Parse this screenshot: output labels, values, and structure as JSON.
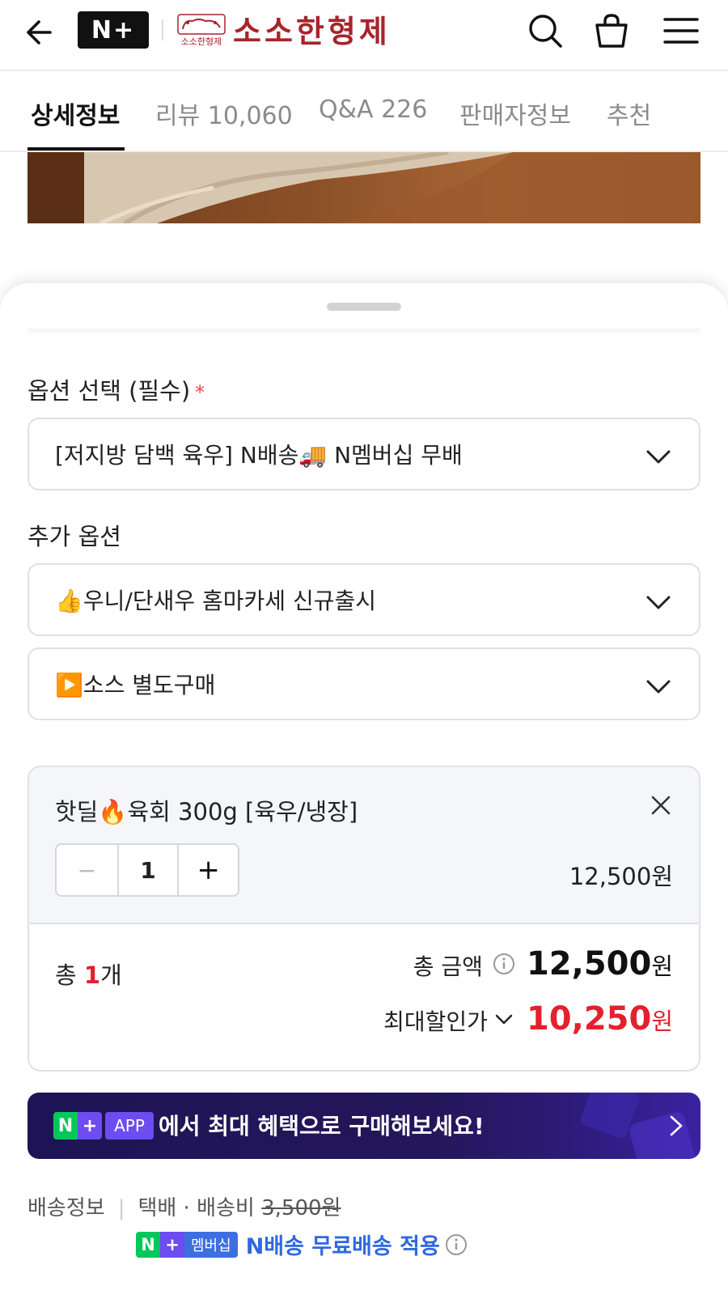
{
  "header": {
    "badge": "N+",
    "brand_name": "소소한형제",
    "brand_logo_text": "소소한형제"
  },
  "tabs": [
    {
      "label": "상세정보",
      "active": true
    },
    {
      "label": "리뷰 10,060",
      "active": false
    },
    {
      "label": "Q&A 226",
      "active": false
    },
    {
      "label": "판매자정보",
      "active": false
    },
    {
      "label": "추천",
      "active": false
    }
  ],
  "options": {
    "required_label": "옵션 선택 (필수)",
    "required_mark": "*",
    "required_value": "[저지방 담백 육우] N배송🚚 N멤버십 무배",
    "additional_label": "추가 옵션",
    "additional": [
      {
        "value": "👍우니/단새우 홈마카세 신규출시"
      },
      {
        "value": "▶️소스 별도구매"
      }
    ]
  },
  "item": {
    "name": "핫딜🔥육회 300g [육우/냉장]",
    "quantity": "1",
    "minus": "−",
    "plus": "+",
    "price": "12,500원"
  },
  "summary": {
    "total_count_prefix": "총 ",
    "total_count": "1",
    "total_count_suffix": "개",
    "total_label": "총 금액",
    "total_amount": "12,500",
    "total_currency": "원",
    "discount_label": "최대할인가",
    "discount_amount": "10,250",
    "discount_currency": "원"
  },
  "banner": {
    "badge_n": "N",
    "badge_plus": "+",
    "badge_app": "APP",
    "text": "에서 최대 혜택으로 구매해보세요!"
  },
  "shipping": {
    "label": "배송정보",
    "method": "택배 · 배송비",
    "original_fee": "3,500원",
    "badge_n": "N",
    "badge_plus": "+",
    "badge_membership": "멤버십",
    "free_text": "N배송 무료배송 적용"
  },
  "colors": {
    "brand": "#a8242c",
    "discount": "#e5202e",
    "npay_green": "#03c75a",
    "app_purple": "#6d4cf0",
    "link_blue": "#2f68e0"
  }
}
